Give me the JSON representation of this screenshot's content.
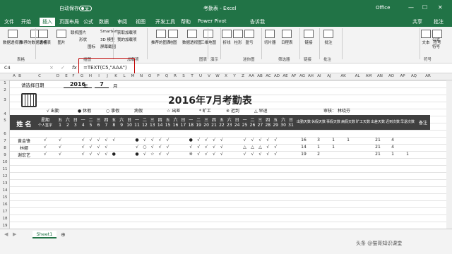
{
  "titlebar": {
    "autosave": "自动保存",
    "autosave_state": "关",
    "title": "考勤表 - Excel",
    "account": "Office"
  },
  "tabs": [
    "文件",
    "开始",
    "插入",
    "页面布局",
    "公式",
    "数据",
    "审阅",
    "视图",
    "开发工具",
    "帮助",
    "Power Pivot"
  ],
  "tell_me": "告诉我",
  "share": "共享",
  "comment": "批注",
  "ribbon": {
    "items": [
      "数据透视表",
      "推荐的数据透视表",
      "表格",
      "图片",
      "联机图片",
      "形状",
      "图标",
      "SmartArt",
      "3D 模型",
      "屏幕截图",
      "获取加载项",
      "我的加载项",
      "推荐的图表",
      "地图",
      "数据透视图",
      "三维地图",
      "折线",
      "柱形",
      "盈亏",
      "切片器",
      "日程表",
      "链接",
      "批注",
      "文本",
      "符号",
      "公式",
      "符号"
    ],
    "groups": [
      "表格",
      "插图",
      "加载项",
      "图表",
      "演示",
      "迷你图",
      "筛选器",
      "链接",
      "批注",
      "符号"
    ]
  },
  "formula_bar": {
    "name_box": "C4",
    "cancel": "×",
    "enter": "✓",
    "fx": "fx",
    "formula": "=TEXT(C5,\"AAA\")"
  },
  "columns": [
    "A",
    "B",
    "C",
    "D",
    "E",
    "F",
    "G",
    "H",
    "I",
    "J",
    "K",
    "L",
    "M",
    "N",
    "O",
    "P",
    "Q",
    "R",
    "S",
    "T",
    "U",
    "V",
    "W",
    "X",
    "Y",
    "Z",
    "AA",
    "AB",
    "AC",
    "AD",
    "AE",
    "AF",
    "AG",
    "AH",
    "AI",
    "AJ",
    "AK",
    "AL",
    "AM",
    "AN",
    "AO",
    "AP",
    "AQ",
    "AR"
  ],
  "rows": [
    "1",
    "2",
    "3",
    "4",
    "5",
    "6",
    "7",
    "8",
    "9",
    "10",
    "11",
    "12",
    "13",
    "14",
    "15",
    "16",
    "17",
    "18",
    "19",
    "20"
  ],
  "sheet": {
    "select_date_label": "请选择日期",
    "year": "2016",
    "year_unit": "年",
    "month": "7",
    "month_unit": "月",
    "title": "2016年7月考勤表",
    "legend": [
      "√ 出勤",
      "● 休假",
      "○ 事假",
      "病假",
      "☆ 出差",
      "* 旷工",
      "※ 迟到",
      "△ 早退"
    ],
    "auditor_label": "审核：",
    "auditor": "林晓芬",
    "name_header": "姓 名",
    "weekday_header": "星期",
    "person_header": "个人签字",
    "weekdays": [
      "五",
      "六",
      "日",
      "一",
      "二",
      "三",
      "四",
      "五",
      "六",
      "日",
      "一",
      "二",
      "三",
      "四",
      "五",
      "六",
      "日",
      "一",
      "二",
      "三",
      "四",
      "五",
      "六",
      "日",
      "一",
      "二",
      "三",
      "四",
      "五",
      "六",
      "日"
    ],
    "days": [
      "1",
      "2",
      "3",
      "4",
      "5",
      "6",
      "7",
      "8",
      "9",
      "10",
      "11",
      "12",
      "13",
      "14",
      "15",
      "16",
      "17",
      "18",
      "19",
      "20",
      "21",
      "22",
      "23",
      "24",
      "25",
      "26",
      "27",
      "28",
      "29",
      "30",
      "31"
    ],
    "summary_headers": [
      "出勤天数",
      "休假天数",
      "事假天数",
      "病假天数",
      "旷工天数",
      "出差天数",
      "迟到次数",
      "早退次数"
    ],
    "remark_header": "备注",
    "employees": [
      {
        "name": "黄金锋",
        "marks": [
          "√",
          "",
          "",
          "√",
          "√",
          "√",
          "√",
          "√",
          "",
          "",
          "●",
          "√",
          "√",
          "√",
          "√",
          "",
          "",
          "●",
          "√",
          "√",
          "√",
          "√",
          "",
          "",
          "√",
          "√",
          "√",
          "√",
          "√",
          "",
          ""
        ],
        "summary": [
          "16",
          "3",
          "1",
          "1",
          "",
          "21",
          "4",
          ""
        ]
      },
      {
        "name": "林娜",
        "marks": [
          "√",
          "",
          "",
          "√",
          "√",
          "√",
          "√",
          "",
          "",
          "",
          "√",
          "○",
          "√",
          "√",
          "√",
          "",
          "",
          "√",
          "√",
          "√",
          "√",
          "√",
          "",
          "",
          "△",
          "△",
          "△",
          "√",
          "√",
          "",
          ""
        ],
        "summary": [
          "14",
          "1",
          "1",
          "",
          "",
          "21",
          "4",
          ""
        ]
      },
      {
        "name": "谢宏艺",
        "marks": [
          "√",
          "",
          "",
          "√",
          "√",
          "√",
          "√",
          "●",
          "",
          "",
          "●",
          "√",
          "☆",
          "√",
          "√",
          "",
          "",
          "※",
          "√",
          "√",
          "√",
          "√",
          "",
          "",
          "√",
          "√",
          "√",
          "√",
          "√",
          "",
          ""
        ],
        "summary": [
          "19",
          "2",
          "",
          "",
          "",
          "21",
          "1",
          "1"
        ]
      }
    ]
  },
  "status": {
    "sheet_tab": "Sheet1",
    "watermark": "头条 @猫哥知识课堂"
  },
  "colors": {
    "excel_green": "#217346",
    "header_dark": "#404040",
    "highlight_red": "#c00000"
  }
}
